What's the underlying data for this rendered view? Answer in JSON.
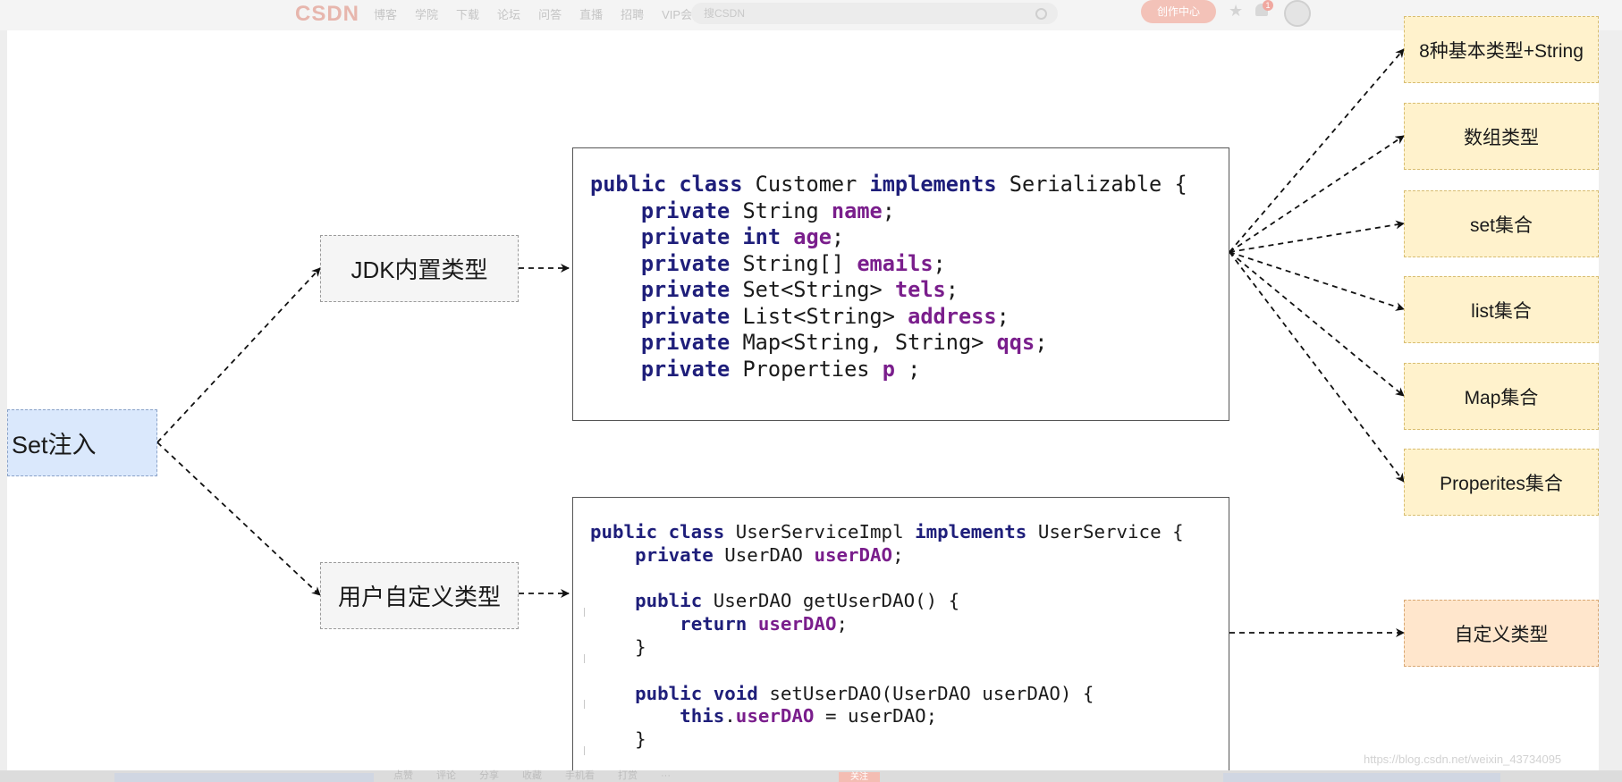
{
  "browser": {
    "logo": "CSDN",
    "nav": [
      "博客",
      "学院",
      "下载",
      "论坛",
      "问答",
      "直播",
      "招聘",
      "VIP会员"
    ],
    "search_placeholder": "搜CSDN",
    "create_label": "创作中心",
    "notification_count": "1"
  },
  "diagram": {
    "root": "Set注入",
    "branches": [
      "JDK内置类型",
      "用户自定义类型"
    ],
    "jdk_types": [
      "8种基本类型+String",
      "数组类型",
      "set集合",
      "list集合",
      "Map集合",
      "Properites集合"
    ],
    "custom_type": "自定义类型",
    "code_customer": [
      [
        [
          "kw",
          "public class "
        ],
        [
          "tx",
          "Customer "
        ],
        [
          "kw",
          "implements "
        ],
        [
          "tx",
          "Serializable {"
        ]
      ],
      [
        [
          "tx",
          "    "
        ],
        [
          "kw",
          "private "
        ],
        [
          "tx",
          "String "
        ],
        [
          "id",
          "name"
        ],
        [
          "tx",
          ";"
        ]
      ],
      [
        [
          "tx",
          "    "
        ],
        [
          "kw",
          "private int "
        ],
        [
          "id",
          "age"
        ],
        [
          "tx",
          ";"
        ]
      ],
      [
        [
          "tx",
          "    "
        ],
        [
          "kw",
          "private "
        ],
        [
          "tx",
          "String[] "
        ],
        [
          "id",
          "emails"
        ],
        [
          "tx",
          ";"
        ]
      ],
      [
        [
          "tx",
          "    "
        ],
        [
          "kw",
          "private "
        ],
        [
          "tx",
          "Set<String> "
        ],
        [
          "id",
          "tels"
        ],
        [
          "tx",
          ";"
        ]
      ],
      [
        [
          "tx",
          "    "
        ],
        [
          "kw",
          "private "
        ],
        [
          "tx",
          "List<String> "
        ],
        [
          "id",
          "address"
        ],
        [
          "tx",
          ";"
        ]
      ],
      [
        [
          "tx",
          "    "
        ],
        [
          "kw",
          "private "
        ],
        [
          "tx",
          "Map<String, String> "
        ],
        [
          "id",
          "qqs"
        ],
        [
          "tx",
          ";"
        ]
      ],
      [
        [
          "tx",
          "    "
        ],
        [
          "kw",
          "private "
        ],
        [
          "tx",
          "Properties "
        ],
        [
          "id",
          "p"
        ],
        [
          "tx",
          " ;"
        ]
      ]
    ],
    "code_userservice": [
      [
        [
          "kw",
          "public class "
        ],
        [
          "tx",
          "UserServiceImpl "
        ],
        [
          "kw",
          "implements "
        ],
        [
          "tx",
          "UserService {"
        ]
      ],
      [
        [
          "tx",
          "    "
        ],
        [
          "kw",
          "private "
        ],
        [
          "tx",
          "UserDAO "
        ],
        [
          "id",
          "userDAO"
        ],
        [
          "tx",
          ";"
        ]
      ],
      [],
      [
        [
          "tx",
          "    "
        ],
        [
          "kw",
          "public "
        ],
        [
          "tx",
          "UserDAO getUserDAO() {"
        ]
      ],
      [
        [
          "tx",
          "        "
        ],
        [
          "kw",
          "return "
        ],
        [
          "id",
          "userDAO"
        ],
        [
          "tx",
          ";"
        ]
      ],
      [
        [
          "tx",
          "    }"
        ]
      ],
      [],
      [
        [
          "tx",
          "    "
        ],
        [
          "kw",
          "public void "
        ],
        [
          "tx",
          "setUserDAO(UserDAO userDAO) {"
        ]
      ],
      [
        [
          "tx",
          "        "
        ],
        [
          "kw",
          "this"
        ],
        [
          "tx",
          "."
        ],
        [
          "id",
          "userDAO"
        ],
        [
          "tx",
          " = userDAO;"
        ]
      ],
      [
        [
          "tx",
          "    }"
        ]
      ]
    ]
  },
  "colors": {
    "root_fill": "#dae8fc",
    "branch_fill": "#f5f5f5",
    "leaf_fill": "#fff2cc",
    "custom_leaf_fill": "#ffe6cc",
    "keyword": "#1e1e7a",
    "identifier": "#7a1e8c"
  },
  "watermark": "https://blog.csdn.net/weixin_43734095",
  "bottom_bar": [
    "点赞",
    "评论",
    "分享",
    "收藏",
    "手机看",
    "打赏",
    "···"
  ],
  "bottom_follow": "关注"
}
